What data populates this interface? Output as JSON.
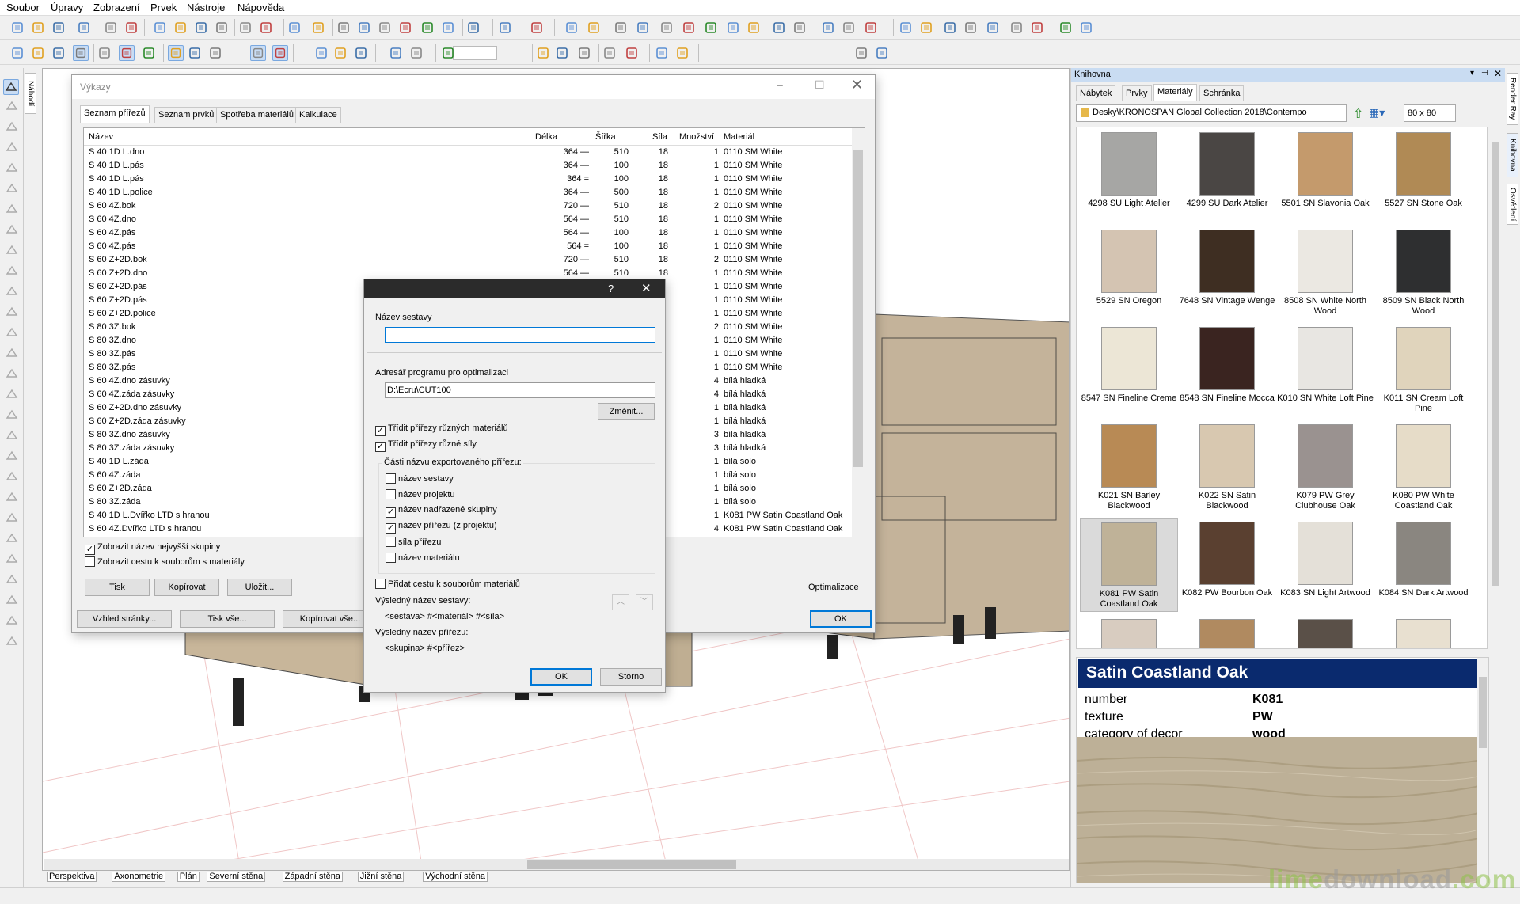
{
  "menu": {
    "items": [
      "Soubor",
      "Úpravy",
      "Zobrazení",
      "Prvek",
      "Nástroje",
      "Nápověda"
    ]
  },
  "viewport": {
    "tabs": [
      "Perspektiva",
      "Axonometrie",
      "Plán",
      "Severní stěna",
      "Západní stěna",
      "Jižní stěna",
      "Východní stěna"
    ]
  },
  "side_tabs": {
    "left": "Náhodí",
    "right": [
      "Render Ray",
      "Knihovna",
      "Osvětlení"
    ]
  },
  "vykazy": {
    "title": "Výkazy",
    "tabs": [
      "Seznam přířezů",
      "Seznam prvků",
      "Spotřeba materiálů",
      "Kalkulace"
    ],
    "columns": [
      "Název",
      "Délka",
      "Šířka",
      "Síla",
      "Množství",
      "Materiál"
    ],
    "rows": [
      [
        "S 40 1D L.dno",
        "364 —",
        "510",
        "18",
        "1",
        "0110 SM White"
      ],
      [
        "S 40 1D L.pás",
        "364 —",
        "100",
        "18",
        "1",
        "0110 SM White"
      ],
      [
        "S 40 1D L.pás",
        "364 =",
        "100",
        "18",
        "1",
        "0110 SM White"
      ],
      [
        "S 40 1D L.police",
        "364 —",
        "500",
        "18",
        "1",
        "0110 SM White"
      ],
      [
        "S 60 4Z.bok",
        "720 —",
        "510",
        "18",
        "2",
        "0110 SM White"
      ],
      [
        "S 60 4Z.dno",
        "564 —",
        "510",
        "18",
        "1",
        "0110 SM White"
      ],
      [
        "S 60 4Z.pás",
        "564 —",
        "100",
        "18",
        "1",
        "0110 SM White"
      ],
      [
        "S 60 4Z.pás",
        "564 =",
        "100",
        "18",
        "1",
        "0110 SM White"
      ],
      [
        "S 60 Z+2D.bok",
        "720 —",
        "510",
        "18",
        "2",
        "0110 SM White"
      ],
      [
        "S 60 Z+2D.dno",
        "564 —",
        "510",
        "18",
        "1",
        "0110 SM White"
      ],
      [
        "S 60 Z+2D.pás",
        "",
        "",
        "",
        "1",
        "0110 SM White"
      ],
      [
        "S 60 Z+2D.pás",
        "",
        "",
        "",
        "1",
        "0110 SM White"
      ],
      [
        "S 60 Z+2D.police",
        "",
        "",
        "",
        "1",
        "0110 SM White"
      ],
      [
        "S 80 3Z.bok",
        "",
        "",
        "",
        "2",
        "0110 SM White"
      ],
      [
        "S 80 3Z.dno",
        "",
        "",
        "",
        "1",
        "0110 SM White"
      ],
      [
        "S 80 3Z.pás",
        "",
        "",
        "",
        "1",
        "0110 SM White"
      ],
      [
        "S 80 3Z.pás",
        "",
        "",
        "",
        "1",
        "0110 SM White"
      ],
      [
        "S 60 4Z.dno zásuvky",
        "",
        "",
        "",
        "4",
        "bílá hladká"
      ],
      [
        "S 60 4Z.záda zásuvky",
        "",
        "",
        "",
        "4",
        "bílá hladká"
      ],
      [
        "S 60 Z+2D.dno zásuvky",
        "",
        "",
        "",
        "1",
        "bílá hladká"
      ],
      [
        "S 60 Z+2D.záda zásuvky",
        "",
        "",
        "",
        "1",
        "bílá hladká"
      ],
      [
        "S 80 3Z.dno zásuvky",
        "",
        "",
        "",
        "3",
        "bílá hladká"
      ],
      [
        "S 80 3Z.záda zásuvky",
        "",
        "",
        "",
        "3",
        "bílá hladká"
      ],
      [
        "S 40 1D L.záda",
        "",
        "",
        "",
        "1",
        "bílá solo"
      ],
      [
        "S 60 4Z.záda",
        "",
        "",
        "",
        "1",
        "bílá solo"
      ],
      [
        "S 60 Z+2D.záda",
        "",
        "",
        "",
        "1",
        "bílá solo"
      ],
      [
        "S 80 3Z.záda",
        "",
        "",
        "",
        "1",
        "bílá solo"
      ],
      [
        "S 40 1D L.Dvířko LTD s hranou",
        "",
        "",
        "",
        "1",
        "K081 PW Satin Coastland Oak"
      ],
      [
        "S 60 4Z.Dvířko LTD s hranou",
        "",
        "",
        "",
        "4",
        "K081 PW Satin Coastland Oak"
      ]
    ],
    "check_top_group": "Zobrazit název nejvyšší skupiny",
    "check_paths": "Zobrazit cestu k souborům s materiály",
    "btn_print": "Tisk",
    "btn_copy": "Kopírovat",
    "btn_save": "Uložit...",
    "btn_page": "Vzhled stránky...",
    "btn_print_all": "Tisk vše...",
    "btn_copy_all": "Kopírovat vše...",
    "optimize_label": "Optimalizace",
    "btn_ok": "OK"
  },
  "dialog": {
    "help": "?",
    "name_label": "Název sestavy",
    "name_value": "",
    "dir_label": "Adresář programu pro optimalizaci",
    "dir_value": "D:\\Ecru\\CUT100",
    "change_btn": "Změnit...",
    "sort_materials": "Třídit přířezy různých materiálů",
    "sort_thickness": "Třídit přířezy různé síly",
    "parts_label": "Části názvu exportovaného přířezu:",
    "parts": [
      {
        "label": "název sestavy",
        "checked": false
      },
      {
        "label": "název projektu",
        "checked": false
      },
      {
        "label": "název nadřazené skupiny",
        "checked": true
      },
      {
        "label": "název přířezu (z projektu)",
        "checked": true
      },
      {
        "label": "síla přířezu",
        "checked": false
      },
      {
        "label": "název materiálu",
        "checked": false
      }
    ],
    "add_path": "Přidat cestu k souborům materiálů",
    "result_set_label": "Výsledný název sestavy:",
    "result_set_value": "<sestava> #<materiál> #<síla>",
    "result_cut_label": "Výsledný název přířezu:",
    "result_cut_value": "<skupina> #<přířez>",
    "ok": "OK",
    "cancel": "Storno"
  },
  "library": {
    "title": "Knihovna",
    "tabs": [
      "Nábytek",
      "Prvky",
      "Materiály",
      "Schránka"
    ],
    "path": "Desky\\KRONOSPAN Global Collection 2018\\Contempo",
    "size": "80 x  80",
    "swatches": [
      {
        "name": "4298 SU Light Atelier",
        "color": "#a6a6a4"
      },
      {
        "name": "4299 SU Dark Atelier",
        "color": "#4a4644"
      },
      {
        "name": "5501 SN Slavonia Oak",
        "color": "#c49a6c"
      },
      {
        "name": "5527 SN Stone Oak",
        "color": "#b08a55"
      },
      {
        "name": "5529 SN Oregon",
        "color": "#d4c4b2"
      },
      {
        "name": "7648 SN Vintage Wenge",
        "color": "#3e2e22"
      },
      {
        "name": "8508 SN White North Wood",
        "color": "#ebe8e2"
      },
      {
        "name": "8509 SN Black North Wood",
        "color": "#2e2f30"
      },
      {
        "name": "8547 SN Fineline Creme",
        "color": "#ece6d6"
      },
      {
        "name": "8548 SN Fineline Mocca",
        "color": "#3a2420"
      },
      {
        "name": "K010 SN White Loft Pine",
        "color": "#e8e6e2"
      },
      {
        "name": "K011 SN Cream Loft Pine",
        "color": "#e0d4bc"
      },
      {
        "name": "K021 SN Barley Blackwood",
        "color": "#b88a55"
      },
      {
        "name": "K022 SN Satin Blackwood",
        "color": "#d8c8b0"
      },
      {
        "name": "K079 PW Grey Clubhouse Oak",
        "color": "#9a9290"
      },
      {
        "name": "K080 PW White Coastland Oak",
        "color": "#e6dcc8"
      },
      {
        "name": "K081 PW Satin Coastland Oak",
        "color": "#bfb298"
      },
      {
        "name": "K082 PW Bourbon Oak",
        "color": "#5a4030"
      },
      {
        "name": "K083 SN Light Artwood",
        "color": "#e4e0d8"
      },
      {
        "name": "K084 SN Dark Artwood",
        "color": "#8a8680"
      },
      {
        "name": "",
        "color": "#d8ccc0"
      },
      {
        "name": "",
        "color": "#b08a60"
      },
      {
        "name": "",
        "color": "#5a5048"
      },
      {
        "name": "",
        "color": "#e8e0d0"
      }
    ],
    "selected_index": 16,
    "detail": {
      "title": "Satin Coastland Oak",
      "props": [
        {
          "key": "number",
          "value": "K081"
        },
        {
          "key": "texture",
          "value": "PW"
        },
        {
          "key": "category of decor",
          "value": "wood"
        }
      ]
    }
  },
  "watermark": {
    "part1": "lime",
    "part2": "download",
    "part3": ".com"
  },
  "colors": {
    "accent": "#0078d7",
    "detail_header": "#0a2a6e",
    "wood": "#bfb298"
  }
}
